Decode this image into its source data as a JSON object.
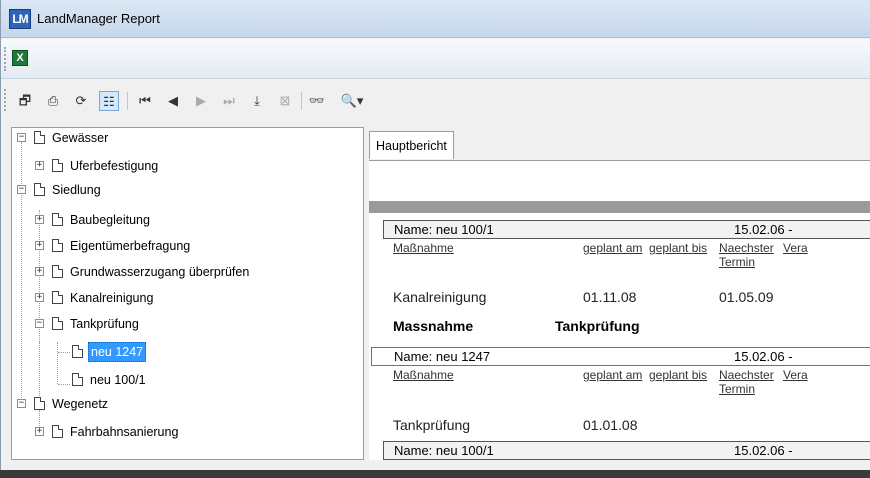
{
  "window": {
    "title": "LandManager Report",
    "logo_text": "LM"
  },
  "toolbar1": {
    "excel_label": "X"
  },
  "toolbar2": {
    "buttons": [
      {
        "name": "export-icon",
        "glyph": "🗗"
      },
      {
        "name": "print-icon",
        "glyph": "⎙"
      },
      {
        "name": "refresh-icon",
        "glyph": "⟳"
      },
      {
        "name": "group-tree-icon",
        "glyph": "☷"
      },
      {
        "name": "first-page-icon",
        "glyph": "⏮"
      },
      {
        "name": "prev-page-icon",
        "glyph": "◀"
      },
      {
        "name": "next-page-icon",
        "glyph": "▶"
      },
      {
        "name": "last-page-icon",
        "glyph": "⏭"
      },
      {
        "name": "goto-page-icon",
        "glyph": "⤓"
      },
      {
        "name": "stop-icon",
        "glyph": "⊠"
      },
      {
        "name": "search-icon",
        "glyph": "👓"
      },
      {
        "name": "zoom-icon",
        "glyph": "🔍▾"
      }
    ]
  },
  "tree": {
    "items": [
      {
        "label": "Gewässer",
        "expander": "−"
      },
      {
        "label": "Uferbefestigung",
        "expander": "+"
      },
      {
        "label": "Siedlung",
        "expander": "−"
      },
      {
        "label": "Baubegleitung",
        "expander": "+"
      },
      {
        "label": "Eigentümerbefragung",
        "expander": "+"
      },
      {
        "label": "Grundwasserzugang überprüfen",
        "expander": "+"
      },
      {
        "label": "Kanalreinigung",
        "expander": "+"
      },
      {
        "label": "Tankprüfung",
        "expander": "−"
      },
      {
        "label": "neu 1247",
        "expander": ""
      },
      {
        "label": "neu 100/1",
        "expander": ""
      },
      {
        "label": "Wegenetz",
        "expander": "−"
      },
      {
        "label": "Fahrbahnsanierung",
        "expander": "+"
      }
    ]
  },
  "report": {
    "tab_label": "Hauptbericht",
    "block1": {
      "name": "Name:  neu 100/1",
      "date": "15.02.06   -",
      "headers": [
        "Maßnahme",
        "geplant am",
        "geplant bis",
        "Naechster",
        "Termin",
        "Vera"
      ],
      "row": {
        "massnahme": "Kanalreinigung",
        "geplant_am": "01.11.08",
        "naechster": "01.05.09"
      }
    },
    "group": {
      "label": "Massnahme",
      "value": "Tankprüfung"
    },
    "block2": {
      "name": "Name:  neu 1247",
      "date": "15.02.06   -",
      "headers": [
        "Maßnahme",
        "geplant am",
        "geplant bis",
        "Naechster",
        "Termin",
        "Vera"
      ],
      "row": {
        "massnahme": "Tankprüfung",
        "geplant_am": "01.01.08"
      }
    },
    "block3": {
      "name": "Name:  neu 100/1",
      "date": "15.02.06   -"
    }
  }
}
